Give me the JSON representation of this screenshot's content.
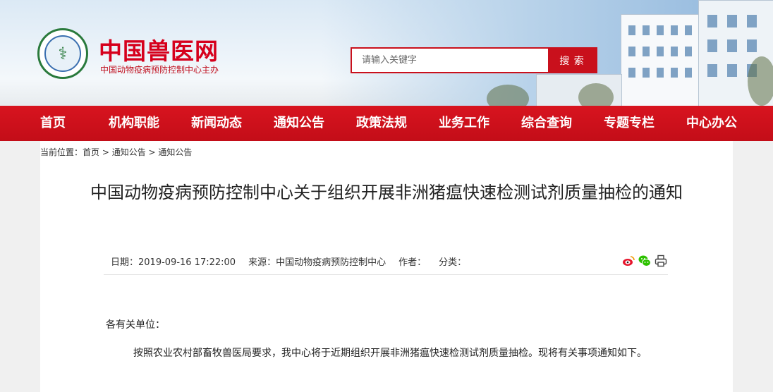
{
  "site": {
    "title": "中国兽医网",
    "subtitle": "中国动物疫病预防控制中心主办",
    "logo_icon": "caduceus-seal-icon"
  },
  "search": {
    "placeholder": "请输入关键字",
    "button_label": "搜 索"
  },
  "nav": {
    "items": [
      {
        "label": "首页"
      },
      {
        "label": "机构职能"
      },
      {
        "label": "新闻动态"
      },
      {
        "label": "通知公告"
      },
      {
        "label": "政策法规"
      },
      {
        "label": "业务工作"
      },
      {
        "label": "综合查询"
      },
      {
        "label": "专题专栏"
      },
      {
        "label": "中心办公"
      }
    ]
  },
  "breadcrumb": {
    "prefix": "当前位置：",
    "home": "首页",
    "sep1": " > ",
    "section": "通知公告",
    "sep2": " > ",
    "current": "通知公告"
  },
  "article": {
    "title": "中国动物疫病预防控制中心关于组织开展非洲猪瘟快速检测试剂质量抽检的通知",
    "date": "日期：2019-09-16 17:22:00",
    "source": "来源：中国动物疫病预防控制中心",
    "author": "作者：",
    "category": "分类：",
    "salutation": "各有关单位：",
    "paragraph1": "按照农业农村部畜牧兽医局要求，我中心将于近期组织开展非洲猪瘟快速检测试剂质量抽检。现将有关事项通知如下。"
  },
  "share_icons": [
    "weibo-icon",
    "wechat-icon",
    "print-icon"
  ],
  "colors": {
    "brand_red": "#c9101c",
    "nav_red": "#d01019",
    "title_red": "#d6001c"
  }
}
